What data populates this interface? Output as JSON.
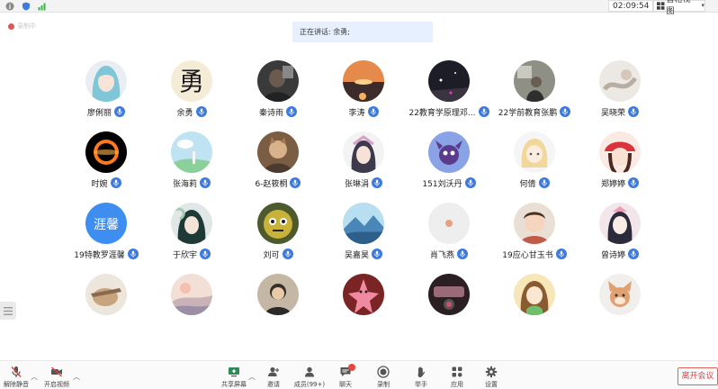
{
  "topbar": {
    "time": "02:09:54",
    "view_label": "宫格视图"
  },
  "recording_label": "录制中",
  "speaking_text": "正在讲话: 余勇;",
  "participants": [
    {
      "name": "廖俐丽",
      "avatar": "anime-girl"
    },
    {
      "name": "余勇",
      "avatar": "calligraphy",
      "glyph": "勇"
    },
    {
      "name": "秦诗雨",
      "avatar": "dark-photo"
    },
    {
      "name": "李涛",
      "avatar": "sunset"
    },
    {
      "name": "22教育学原理邓...",
      "avatar": "night-city"
    },
    {
      "name": "22学前教育张鹏",
      "avatar": "gray-photo"
    },
    {
      "name": "吴晓荣",
      "avatar": "ink-wash"
    },
    {
      "name": "时婉",
      "avatar": "black-hole"
    },
    {
      "name": "张海莉",
      "avatar": "sky-landscape"
    },
    {
      "name": "6-赵筱桐",
      "avatar": "cat-person"
    },
    {
      "name": "张琳涓",
      "avatar": "girl-portrait"
    },
    {
      "name": "151刘沃丹",
      "avatar": "purple-cartoon"
    },
    {
      "name": "何倩",
      "avatar": "cartoon-blonde"
    },
    {
      "name": "郑婷婷",
      "avatar": "red-hat-girl"
    },
    {
      "name": "19特教罗涯馨",
      "avatar": "text",
      "glyph": "涯馨"
    },
    {
      "name": "于欣宇",
      "avatar": "anime-boy"
    },
    {
      "name": "刘可",
      "avatar": "yellow-creature"
    },
    {
      "name": "吴嘉昊",
      "avatar": "blue-mountain"
    },
    {
      "name": "肖飞燕",
      "avatar": "light-dot"
    },
    {
      "name": "19应心甘玉书",
      "avatar": "child-photo"
    },
    {
      "name": "曾诗婷",
      "avatar": "anime-girl-pink"
    },
    {
      "name": "",
      "avatar": "tan-cartoon"
    },
    {
      "name": "",
      "avatar": "pastel-hills"
    },
    {
      "name": "",
      "avatar": "cartoon-man"
    },
    {
      "name": "",
      "avatar": "patrick-star"
    },
    {
      "name": "",
      "avatar": "car-interior"
    },
    {
      "name": "",
      "avatar": "cartoon-green-girl"
    },
    {
      "name": "",
      "avatar": "fox-doll"
    }
  ],
  "toolbar": {
    "mute": "解除静音",
    "video": "开启视频",
    "share": "共享屏幕",
    "invite": "邀请",
    "members": "成员(99+)",
    "chat": "聊天",
    "record": "录制",
    "raise_hand": "举手",
    "apps": "应用",
    "settings": "设置",
    "leave": "离开会议"
  },
  "colors": {
    "accent": "#3d7ae0",
    "speaking_bg": "#e6f0ff",
    "leave": "#e04040"
  }
}
